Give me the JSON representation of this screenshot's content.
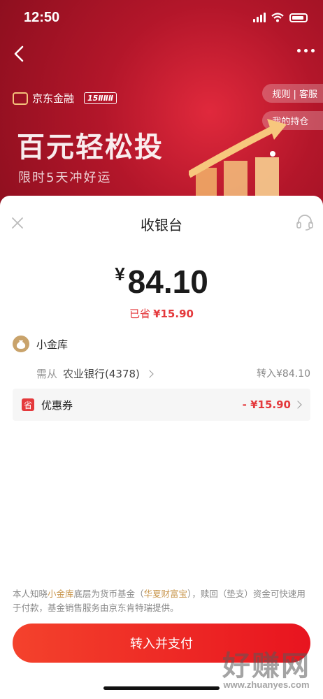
{
  "status": {
    "time": "12:50"
  },
  "banner": {
    "brand": "京东金融",
    "badge": "15ⅡⅡⅡ",
    "side_links": [
      "规则 | 客服",
      "我的持仓"
    ],
    "headline": "百元轻松投",
    "subline": "限时5天冲好运"
  },
  "sheet": {
    "title": "收银台",
    "currency": "¥",
    "amount": "84.10",
    "saved_label": "已省",
    "saved_amount": "¥15.90",
    "fund_name": "小金库",
    "pay_from_label": "需从",
    "bank": "农业银行(4378)",
    "transfer": "转入¥84.10",
    "coupon_label": "优惠券",
    "coupon_icon_text": "省",
    "coupon_value": "- ¥15.90",
    "disclaimer_parts": [
      "本人知晓",
      "小金库",
      "底层为货币基金（",
      "华夏财富宝",
      "），赎回（垫支）资金可快速用于付款，基金销售服务由京东肯特瑞提供。"
    ],
    "submit_label": "转入并支付"
  },
  "watermark": {
    "big": "好赚网",
    "small": "www.zhuanyes.com"
  },
  "colors": {
    "accent": "#e4393c",
    "gold": "#c9974e",
    "banner": "#b3162a"
  }
}
